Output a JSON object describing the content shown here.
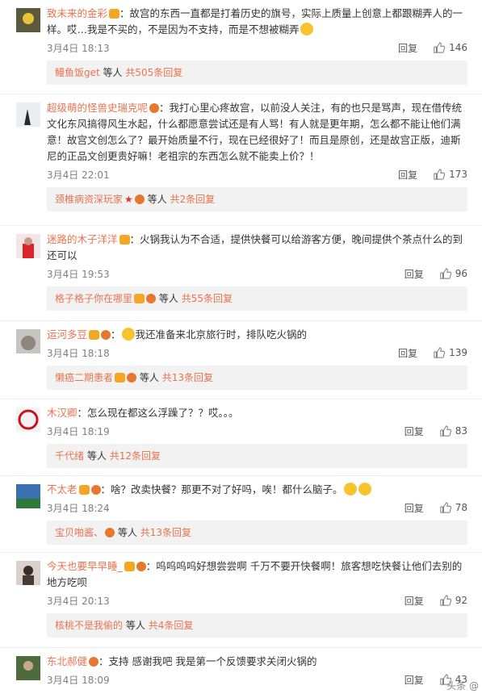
{
  "comments": [
    {
      "user": "致未来的金彩",
      "sep": "：",
      "text": "故宫的东西一直都是打着历史的旗号，实际上质量上创意上都跟糊弄人的一样。哎…我是不买的，不是因为不支持，而是不想被糊弄",
      "date": "3月4日 18:13",
      "reply": "回复",
      "likes": "146",
      "sub_user": "鳗鱼饭get",
      "sub_etc": "等人",
      "sub_total": "共505条回复"
    },
    {
      "user": "超级萌的怪兽史瑞克呢",
      "sep": "：",
      "text": "我打心里心疼故宫，以前没人关注，有的也只是骂声，现在借传统文化东风搞得风生水起，什么都愿意尝试还是有人骂！有人就是更年期，怎么都不能让他们满意！故宫文创怎么了？最开始质量不行，现在已经很好了！而且是原创，还是故宫正版，迪斯尼的正品文创更贵好嘛！老祖宗的东西怎么就不能卖上价？！",
      "date": "3月4日 22:01",
      "reply": "回复",
      "likes": "173",
      "sub_user": "颈椎病资深玩家",
      "sub_etc": "等人",
      "sub_total": "共2条回复"
    },
    {
      "user": "迷路的木子洋洋",
      "sep": "：",
      "text": "火锅我认为不合适，提供快餐可以给游客方便，晚间提供个茶点什么的到还可以",
      "date": "3月4日 19:53",
      "reply": "回复",
      "likes": "96",
      "sub_user": "格子格子你在哪里",
      "sub_etc": "等人",
      "sub_total": "共55条回复"
    },
    {
      "user": "运河多豆",
      "sep": "：",
      "text": "我还准备来北京旅行时，排队吃火锅的",
      "date": "3月4日 18:18",
      "reply": "回复",
      "likes": "139",
      "sub_user": "懒癌二期患者",
      "sub_etc": "等人",
      "sub_total": "共13条回复"
    },
    {
      "user": "木汉卿",
      "sep": "：",
      "text": "怎么现在都这么浮躁了？？哎。。。",
      "date": "3月4日 18:19",
      "reply": "回复",
      "likes": "83",
      "sub_user": "千代绪",
      "sub_etc": "等人",
      "sub_total": "共12条回复"
    },
    {
      "user": "不太老",
      "sep": "：",
      "text": "啥？改卖快餐？那更不对了好吗，唉！都什么脑子。",
      "date": "3月4日 18:24",
      "reply": "回复",
      "likes": "78",
      "sub_user": "宝贝啪酱、",
      "sub_etc": "等人",
      "sub_total": "共13条回复"
    },
    {
      "user": "今天也要早早睡_",
      "sep": "：",
      "text": "呜呜呜呜好想尝尝啊 千万不要开快餐啊！旅客想吃快餐让他们去别的地方吃呗",
      "date": "3月4日 20:13",
      "reply": "回复",
      "likes": "92",
      "sub_user": "核桃不是我偷的",
      "sub_etc": "等人",
      "sub_total": "共4条回复"
    },
    {
      "user": "东北郝健",
      "sep": "：",
      "text": "支持 感谢我吧 我是第一个反馈要求关闭火锅的",
      "date": "3月4日 18:09",
      "reply": "回复",
      "likes": "43"
    }
  ],
  "watermark": "头条 @"
}
